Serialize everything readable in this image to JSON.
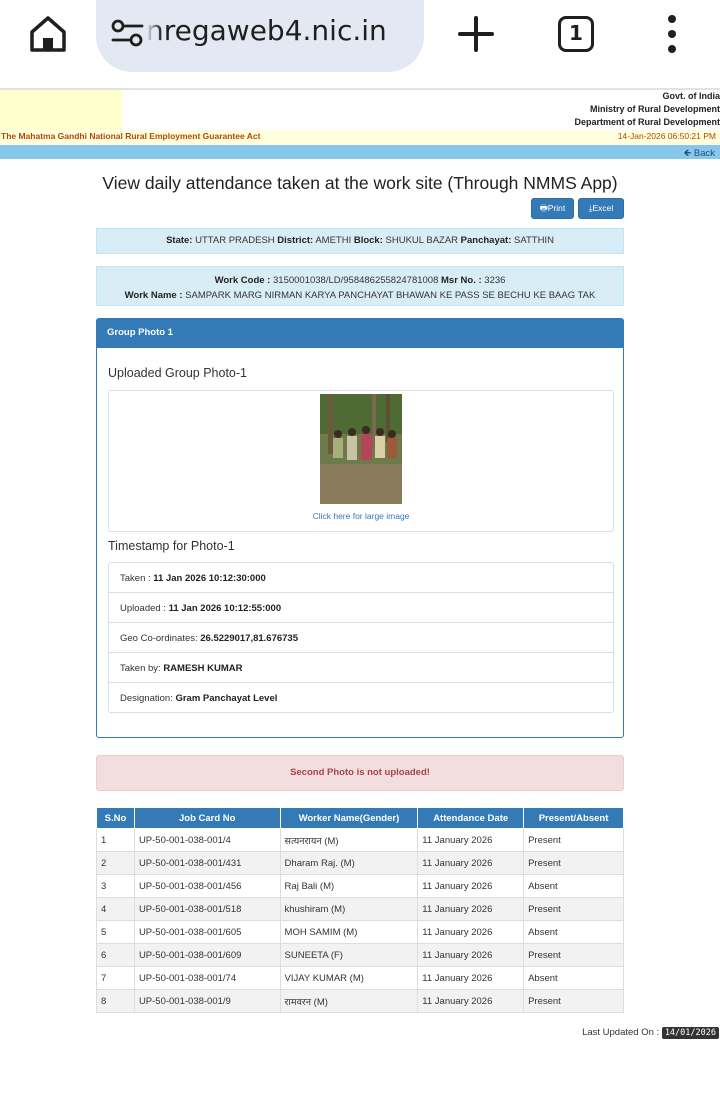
{
  "browser": {
    "url": "nregaweb4.nic.in",
    "tab_count": "1"
  },
  "header": {
    "govt_lines": [
      "Govt. of India",
      "Ministry of Rural Development",
      "Department of Rural Development"
    ],
    "act_name": "The Mahatma Gandhi National Rural Employment Guarantee Act",
    "datetime": "14-Jan-2026 06:50:21 PM",
    "back_label": "Back"
  },
  "page": {
    "title": "View daily attendance taken at the work site (Through NMMS App)",
    "print_label": "Print",
    "excel_label": "Excel"
  },
  "location": {
    "state_label": "State:",
    "state": "UTTAR PRADESH",
    "district_label": "District:",
    "district": "AMETHI",
    "block_label": "Block:",
    "block": "SHUKUL BAZAR",
    "panchayat_label": "Panchayat:",
    "panchayat": "SATTHIN"
  },
  "work": {
    "code_label": "Work Code :",
    "code": "3150001038/LD/958486255824781008",
    "msr_label": "Msr No. :",
    "msr": "3236",
    "name_label": "Work Name :",
    "name": "SAMPARK MARG NIRMAN KARYA PANCHAYAT BHAWAN KE PASS SE BECHU KE BAAG TAK"
  },
  "photo_panel": {
    "heading": "Group Photo 1",
    "uploaded_heading": "Uploaded Group Photo-1",
    "large_image_link": "Click here for large image",
    "timestamp_heading": "Timestamp for Photo-1",
    "taken_label": "Taken :",
    "taken": "11 Jan 2026 10:12:30:000",
    "uploaded_label": "Uploaded :",
    "uploaded": "11 Jan 2026 10:12:55:000",
    "geo_label": "Geo Co-ordinates:",
    "geo": "26.5229017,81.676735",
    "taken_by_label": "Taken by:",
    "taken_by": "RAMESH KUMAR",
    "designation_label": "Designation:",
    "designation": "Gram Panchayat Level"
  },
  "alert": "Second Photo is not uploaded!",
  "table": {
    "headers": [
      "S.No",
      "Job Card No",
      "Worker Name(Gender)",
      "Attendance Date",
      "Present/Absent"
    ],
    "rows": [
      [
        "1",
        "UP-50-001-038-001/4",
        "सत्यनरायन (M)",
        "11 January 2026",
        "Present"
      ],
      [
        "2",
        "UP-50-001-038-001/431",
        "Dharam Raj. (M)",
        "11 January 2026",
        "Present"
      ],
      [
        "3",
        "UP-50-001-038-001/456",
        "Raj Bali (M)",
        "11 January 2026",
        "Absent"
      ],
      [
        "4",
        "UP-50-001-038-001/518",
        "khushiram (M)",
        "11 January 2026",
        "Present"
      ],
      [
        "5",
        "UP-50-001-038-001/605",
        "MOH SAMIM (M)",
        "11 January 2026",
        "Absent"
      ],
      [
        "6",
        "UP-50-001-038-001/609",
        "SUNEETA (F)",
        "11 January 2026",
        "Present"
      ],
      [
        "7",
        "UP-50-001-038-001/74",
        "VIJAY KUMAR (M)",
        "11 January 2026",
        "Absent"
      ],
      [
        "8",
        "UP-50-001-038-001/9",
        "रामवरन (M)",
        "11 January 2026",
        "Present"
      ]
    ]
  },
  "footer": {
    "last_updated_label": "Last Updated On :",
    "last_updated": "14/01/2026"
  }
}
